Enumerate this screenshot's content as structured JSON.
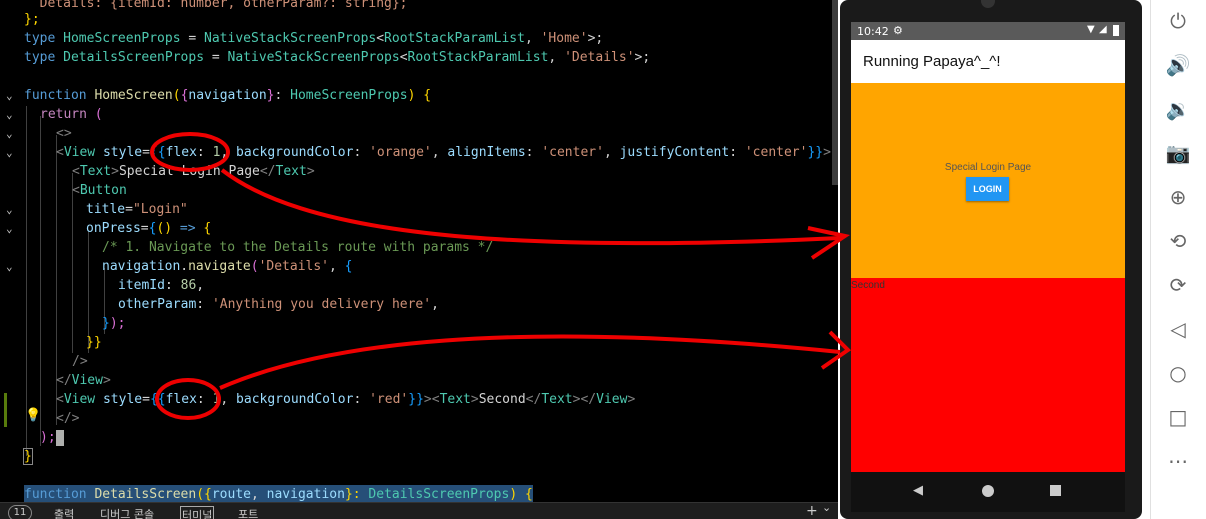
{
  "editor": {
    "lines": {
      "l1": "  Details: {itemId: number, otherParam?: string};",
      "l2": "};",
      "l3a": "type ",
      "l3b": "HomeScreenProps",
      "l3c": " = ",
      "l3d": "NativeStackScreenProps",
      "l3e": "<",
      "l3f": "RootStackParamList",
      "l3g": ", ",
      "l3h": "'Home'",
      "l3i": ">;",
      "l4a": "type ",
      "l4b": "DetailsScreenProps",
      "l4c": " = ",
      "l4d": "NativeStackScreenProps",
      "l4e": "<",
      "l4f": "RootStackParamList",
      "l4g": ", ",
      "l4h": "'Details'",
      "l4i": ">;",
      "l6a": "function ",
      "l6b": "HomeScreen",
      "l6c": "(",
      "l6d": "{",
      "l6e": "navigation",
      "l6f": "}",
      "l6g": ": ",
      "l6h": "HomeScreenProps",
      "l6i": ") ",
      "l6j": "{",
      "l7a": "return ",
      "l7b": "(",
      "l8": "<>",
      "l9a": "<",
      "l9b": "View",
      "l9c": " style",
      "l9d": "=",
      "l9e": "{{",
      "l9f": "flex",
      "l9g": ": ",
      "l9h": "1",
      "l9i": ", ",
      "l9j": "backgroundColor",
      "l9k": ": ",
      "l9l": "'orange'",
      "l9m": ", ",
      "l9n": "alignItems",
      "l9o": ": ",
      "l9p": "'center'",
      "l9q": ", ",
      "l9r": "justifyContent",
      "l9s": ": ",
      "l9t": "'center'",
      "l9u": "}}",
      "l9v": ">",
      "l10a": "<",
      "l10b": "Text",
      "l10c": ">",
      "l10d": "Special Login Page",
      "l10e": "</",
      "l10f": "Text",
      "l10g": ">",
      "l11a": "<",
      "l11b": "Button",
      "l12a": "title",
      "l12b": "=",
      "l12c": "\"Login\"",
      "l13a": "onPress",
      "l13b": "=",
      "l13c": "{",
      "l13d": "()",
      "l13e": " => ",
      "l13f": "{",
      "l14": "/* 1. Navigate to the Details route with params */",
      "l15a": "navigation",
      "l15b": ".",
      "l15c": "navigate",
      "l15d": "(",
      "l15e": "'Details'",
      "l15f": ", ",
      "l15g": "{",
      "l16a": "itemId",
      "l16b": ": ",
      "l16c": "86",
      "l16d": ",",
      "l17a": "otherParam",
      "l17b": ": ",
      "l17c": "'Anything you delivery here'",
      "l17d": ",",
      "l18a": "}",
      "l18b": ");",
      "l19": "}}",
      "l20": "/>",
      "l21a": "</",
      "l21b": "View",
      "l21c": ">",
      "l22a": "<",
      "l22b": "View",
      "l22c": " style",
      "l22d": "=",
      "l22e": "{{",
      "l22f": "flex",
      "l22g": ": ",
      "l22h": "1",
      "l22i": ", ",
      "l22j": "backgroundColor",
      "l22k": ": ",
      "l22l": "'red'",
      "l22m": "}}",
      "l22n": "><",
      "l22o": "Text",
      "l22p": ">",
      "l22q": "Second",
      "l22r": "</",
      "l22s": "Text",
      "l22t": "></",
      "l22u": "View",
      "l22v": ">",
      "l23": "</>",
      "l24a": ");",
      "l25": "}",
      "l27a": "function ",
      "l27b": "DetailsScreen",
      "l27c": "({",
      "l27d": "route",
      "l27e": ", ",
      "l27f": "navigation",
      "l27g": "}: ",
      "l27h": "DetailsScreenProps",
      "l27i": ") {"
    },
    "lightbulb": "💡"
  },
  "bottom_panel": {
    "badge": "11",
    "tabs": [
      "출력",
      "디버그 콘솔",
      "터미널",
      "포트"
    ],
    "plus": "+",
    "chevron": "⌄"
  },
  "phone": {
    "status_time": "10:42",
    "app_title": "Running Papaya^_^!",
    "orange_text": "Special Login Page",
    "login_button": "LOGIN",
    "red_text": "Second",
    "colors": {
      "orange": "#ffa500",
      "red": "#ff0000",
      "button": "#2196f3"
    }
  },
  "toolbar": {
    "icons": [
      "power-icon",
      "volume-up-icon",
      "volume-down-icon",
      "camera-icon",
      "zoom-in-icon",
      "rotate-left-icon",
      "rotate-right-icon",
      "back-icon",
      "home-icon",
      "overview-icon",
      "more-icon"
    ]
  }
}
